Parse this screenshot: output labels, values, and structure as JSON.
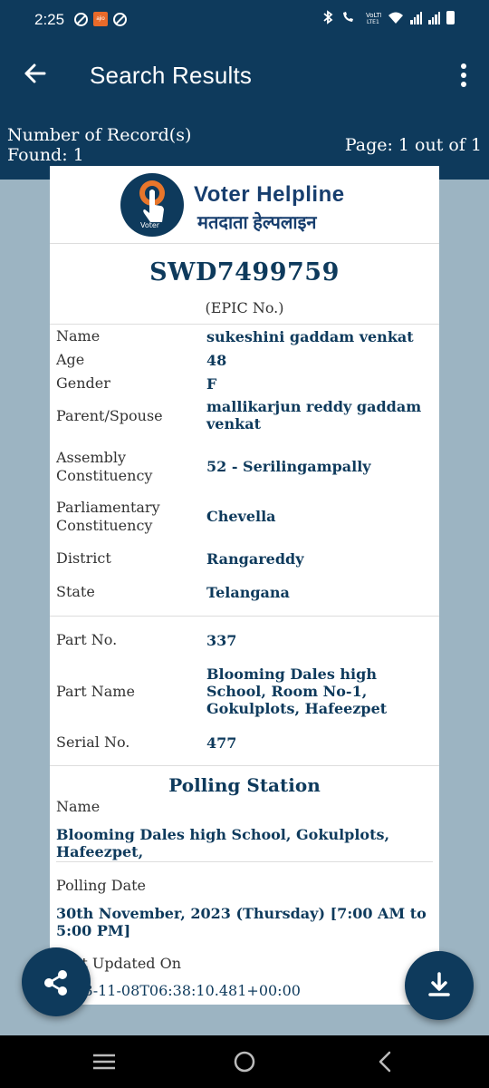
{
  "status_bar": {
    "time": "2:25",
    "app_badge": "ajio"
  },
  "app_bar": {
    "title": "Search Results"
  },
  "records": {
    "count_label": "Number of Record(s) Found: 1",
    "page_label": "Page: 1 out of 1"
  },
  "card": {
    "logo": {
      "title_en": "Voter Helpline",
      "title_hi": "मतदाता हेल्पलाइन",
      "badge_text": "Voter"
    },
    "epic_number": "SWD7499759",
    "epic_label": "(EPIC No.)",
    "details": [
      {
        "label": "Name",
        "value": "sukeshini gaddam venkat"
      },
      {
        "label": "Age",
        "value": "48"
      },
      {
        "label": "Gender",
        "value": "F"
      },
      {
        "label": "Parent/Spouse",
        "value": "mallikarjun reddy gaddam venkat"
      },
      {
        "label": "Assembly Constituency",
        "value": "52 - Serilingampally"
      },
      {
        "label": "Parliamentary Constituency",
        "value": "Chevella"
      },
      {
        "label": "District",
        "value": "Rangareddy"
      },
      {
        "label": "State",
        "value": "Telangana"
      }
    ],
    "part": [
      {
        "label": "Part No.",
        "value": "337"
      },
      {
        "label": "Part Name",
        "value": "Blooming Dales high School, Room No-1, Gokulplots, Hafeezpet"
      },
      {
        "label": "Serial No.",
        "value": "477"
      }
    ],
    "polling_station": {
      "title": "Polling Station",
      "name_label": "Name",
      "name_value": "Blooming Dales high School, Gokulplots, Hafeezpet,",
      "date_label": "Polling Date",
      "date_value": "30th November, 2023 (Thursday) [7:00 AM to 5:00 PM]",
      "updated_label": "Last Updated On",
      "updated_value": "2023-11-08T06:38:10.481+00:00"
    }
  },
  "icons": {
    "back": "arrow-left-icon",
    "menu": "more-vert-icon",
    "share": "share-icon",
    "download": "download-icon",
    "nav_recents": "recents-icon",
    "nav_home": "home-icon",
    "nav_back": "nav-back-icon"
  },
  "colors": {
    "primary": "#0e3a5c",
    "background": "#9cb4c2",
    "card": "#ffffff"
  }
}
